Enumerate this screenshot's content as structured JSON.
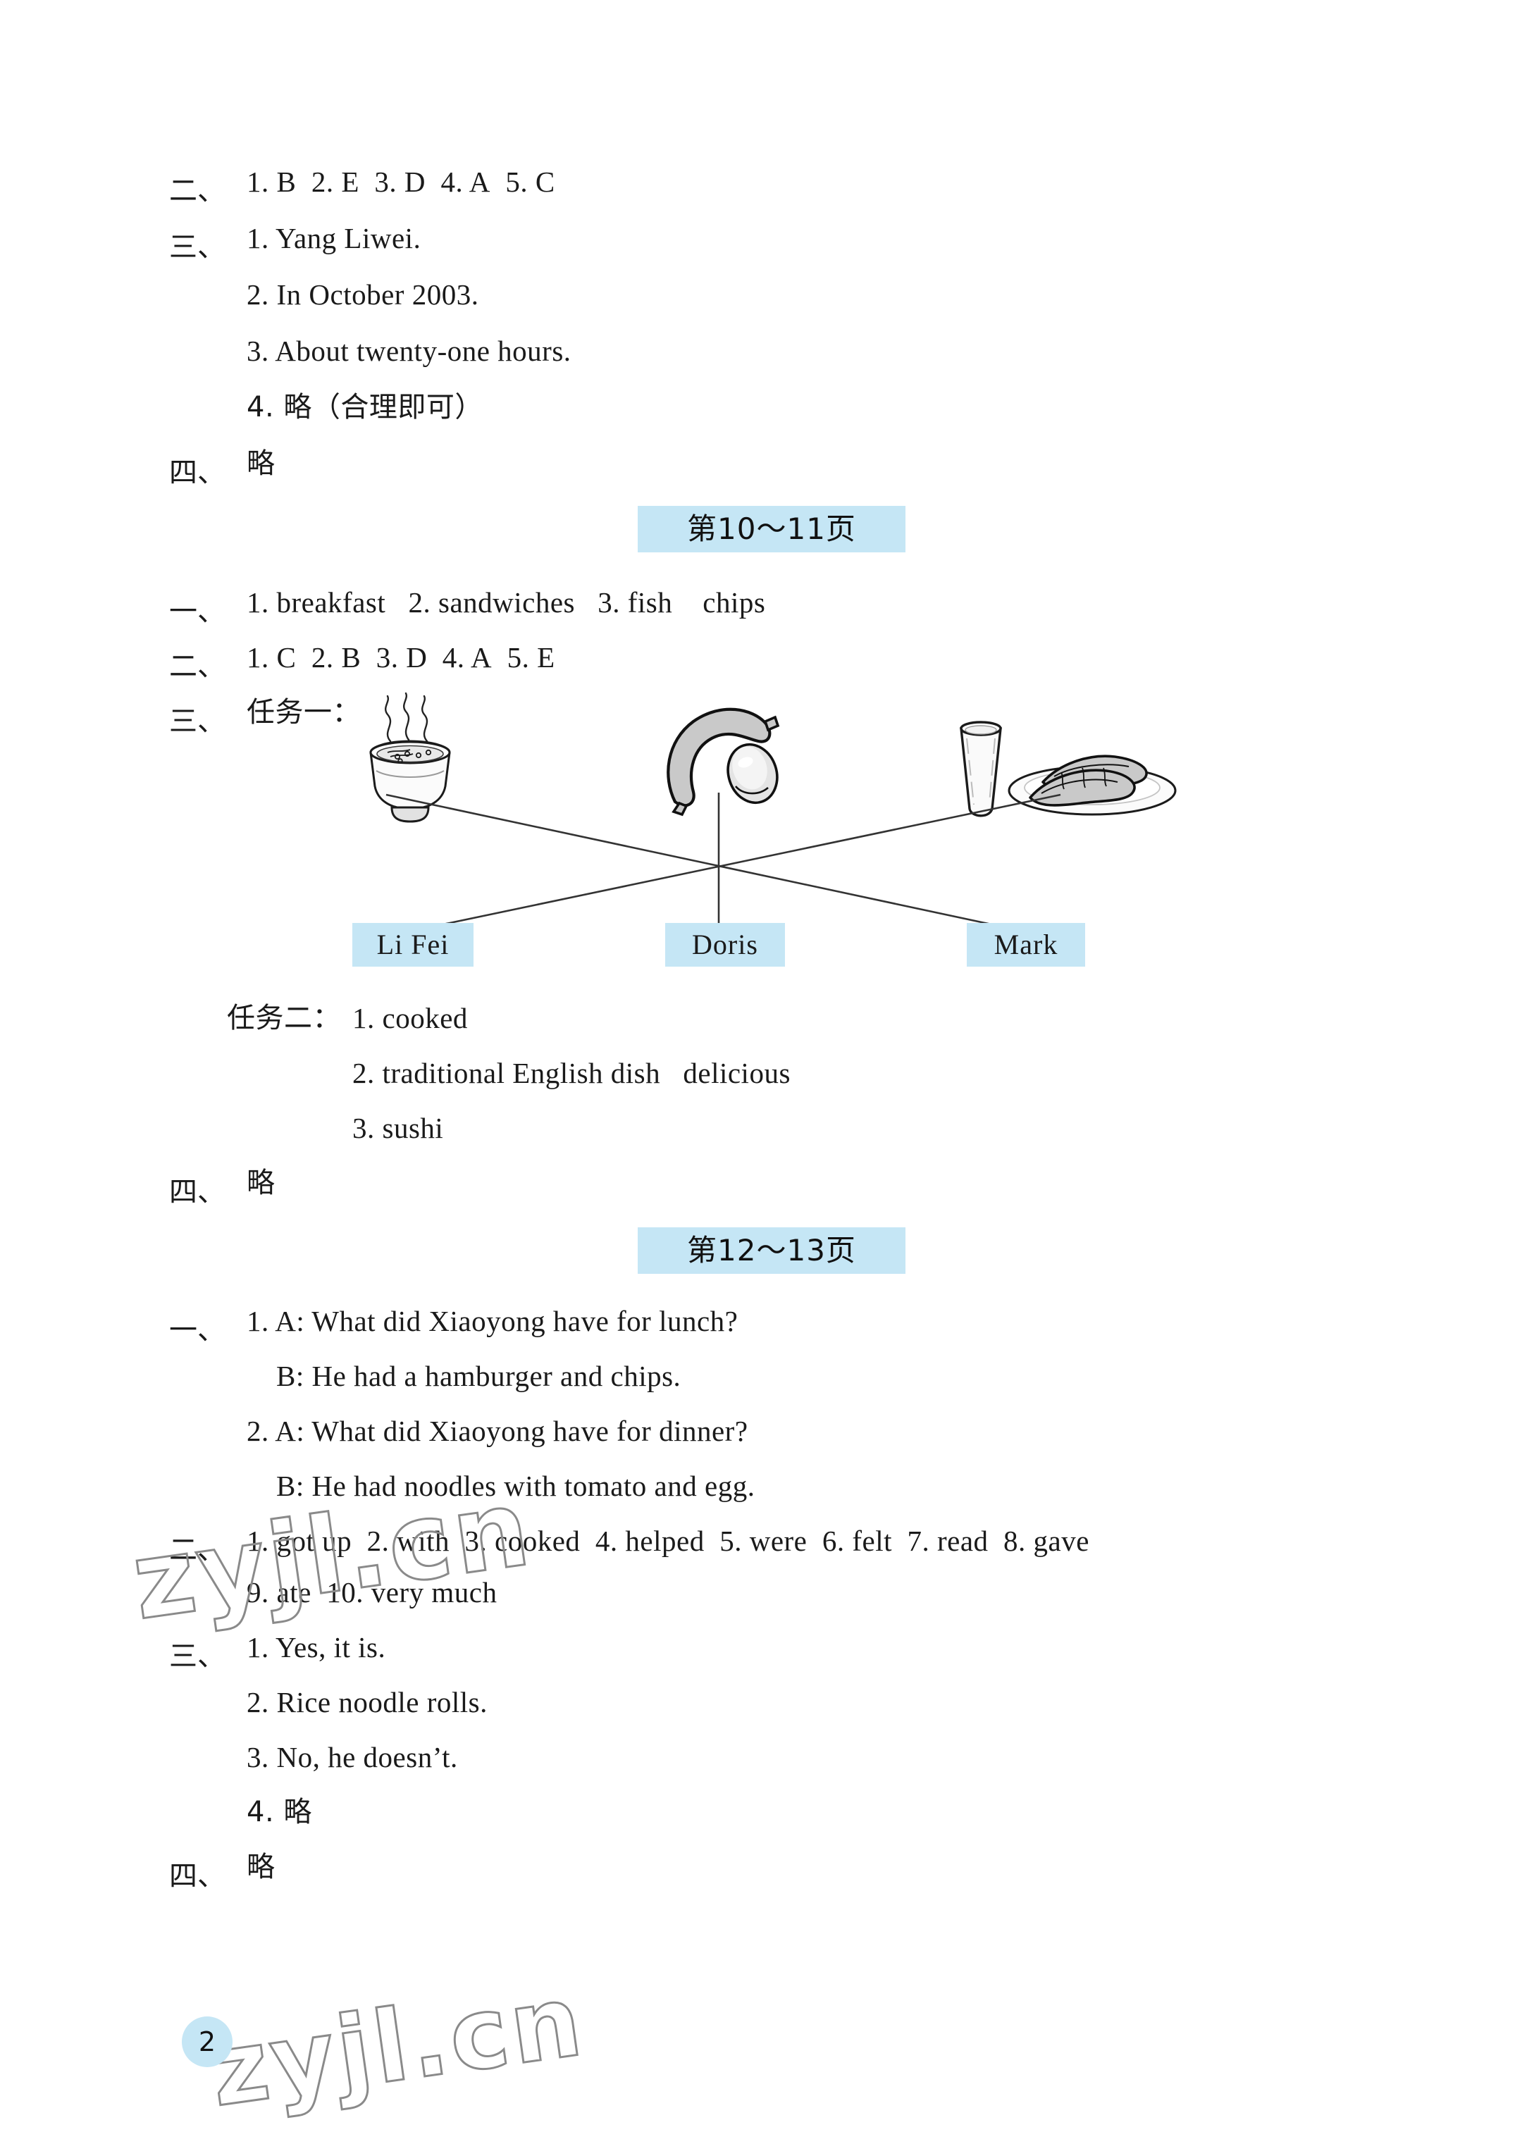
{
  "document": {
    "page_number": "2",
    "watermark": "zyjl.cn"
  },
  "sections": [
    {
      "marker": "二、",
      "lines": [
        "1. B  2. E  3. D  4. A  5. C"
      ]
    },
    {
      "marker": "三、",
      "lines": [
        "1. Yang  Liwei.",
        "2. In  October  2003.",
        "3. About  twenty-one  hours.",
        "4. 略（合理即可）"
      ]
    },
    {
      "marker": "四、",
      "lines": [
        "略"
      ]
    }
  ],
  "block_10_11": {
    "header": "第10～11页",
    "sec1_marker": "一、",
    "sec1_line": "1. breakfast   2. sandwiches   3. fish    chips",
    "sec2_marker": "二、",
    "sec2_line": "1. C  2. B  3. D  4. A  5. E",
    "sec3_marker": "三、",
    "sec3_label": "任务一：",
    "task2_label": "任务二：",
    "task2_lines": [
      "1. cooked",
      "2. traditional  English  dish   delicious",
      "3. sushi"
    ],
    "sec4_marker": "四、",
    "sec4_line": "略",
    "match": {
      "foods": [
        {
          "name": "noodle-soup-bowl",
          "label": "steaming bowl of noodle soup"
        },
        {
          "name": "sausage-and-egg",
          "label": "sausage with fried egg"
        },
        {
          "name": "milk-and-youtiao",
          "label": "glass of milk with fried dough sticks"
        }
      ],
      "names": [
        "Li  Fei",
        "Doris",
        "Mark"
      ]
    }
  },
  "block_12_13": {
    "header": "第12～13页",
    "sec1_marker": "一、",
    "sec1_lines": [
      "1. A: What  did  Xiaoyong  have  for  lunch?",
      "B: He  had  a  hamburger  and  chips.",
      "2. A: What  did  Xiaoyong  have  for  dinner?",
      "B: He  had  noodles  with  tomato  and  egg."
    ],
    "sec2_marker": "二、",
    "sec2_lines": [
      "1. got  up  2. with  3. cooked  4. helped  5. were  6. felt  7. read  8. gave",
      "9. ate  10. very  much"
    ],
    "sec3_marker": "三、",
    "sec3_lines": [
      "1. Yes,  it  is.",
      "2. Rice  noodle  rolls.",
      "3. No,  he  doesn’t.",
      "4. 略"
    ],
    "sec4_marker": "四、",
    "sec4_line": "略"
  },
  "colors": {
    "accent_blue": "#c5e6f5",
    "text": "#1a1a1a",
    "line": "#333333"
  }
}
